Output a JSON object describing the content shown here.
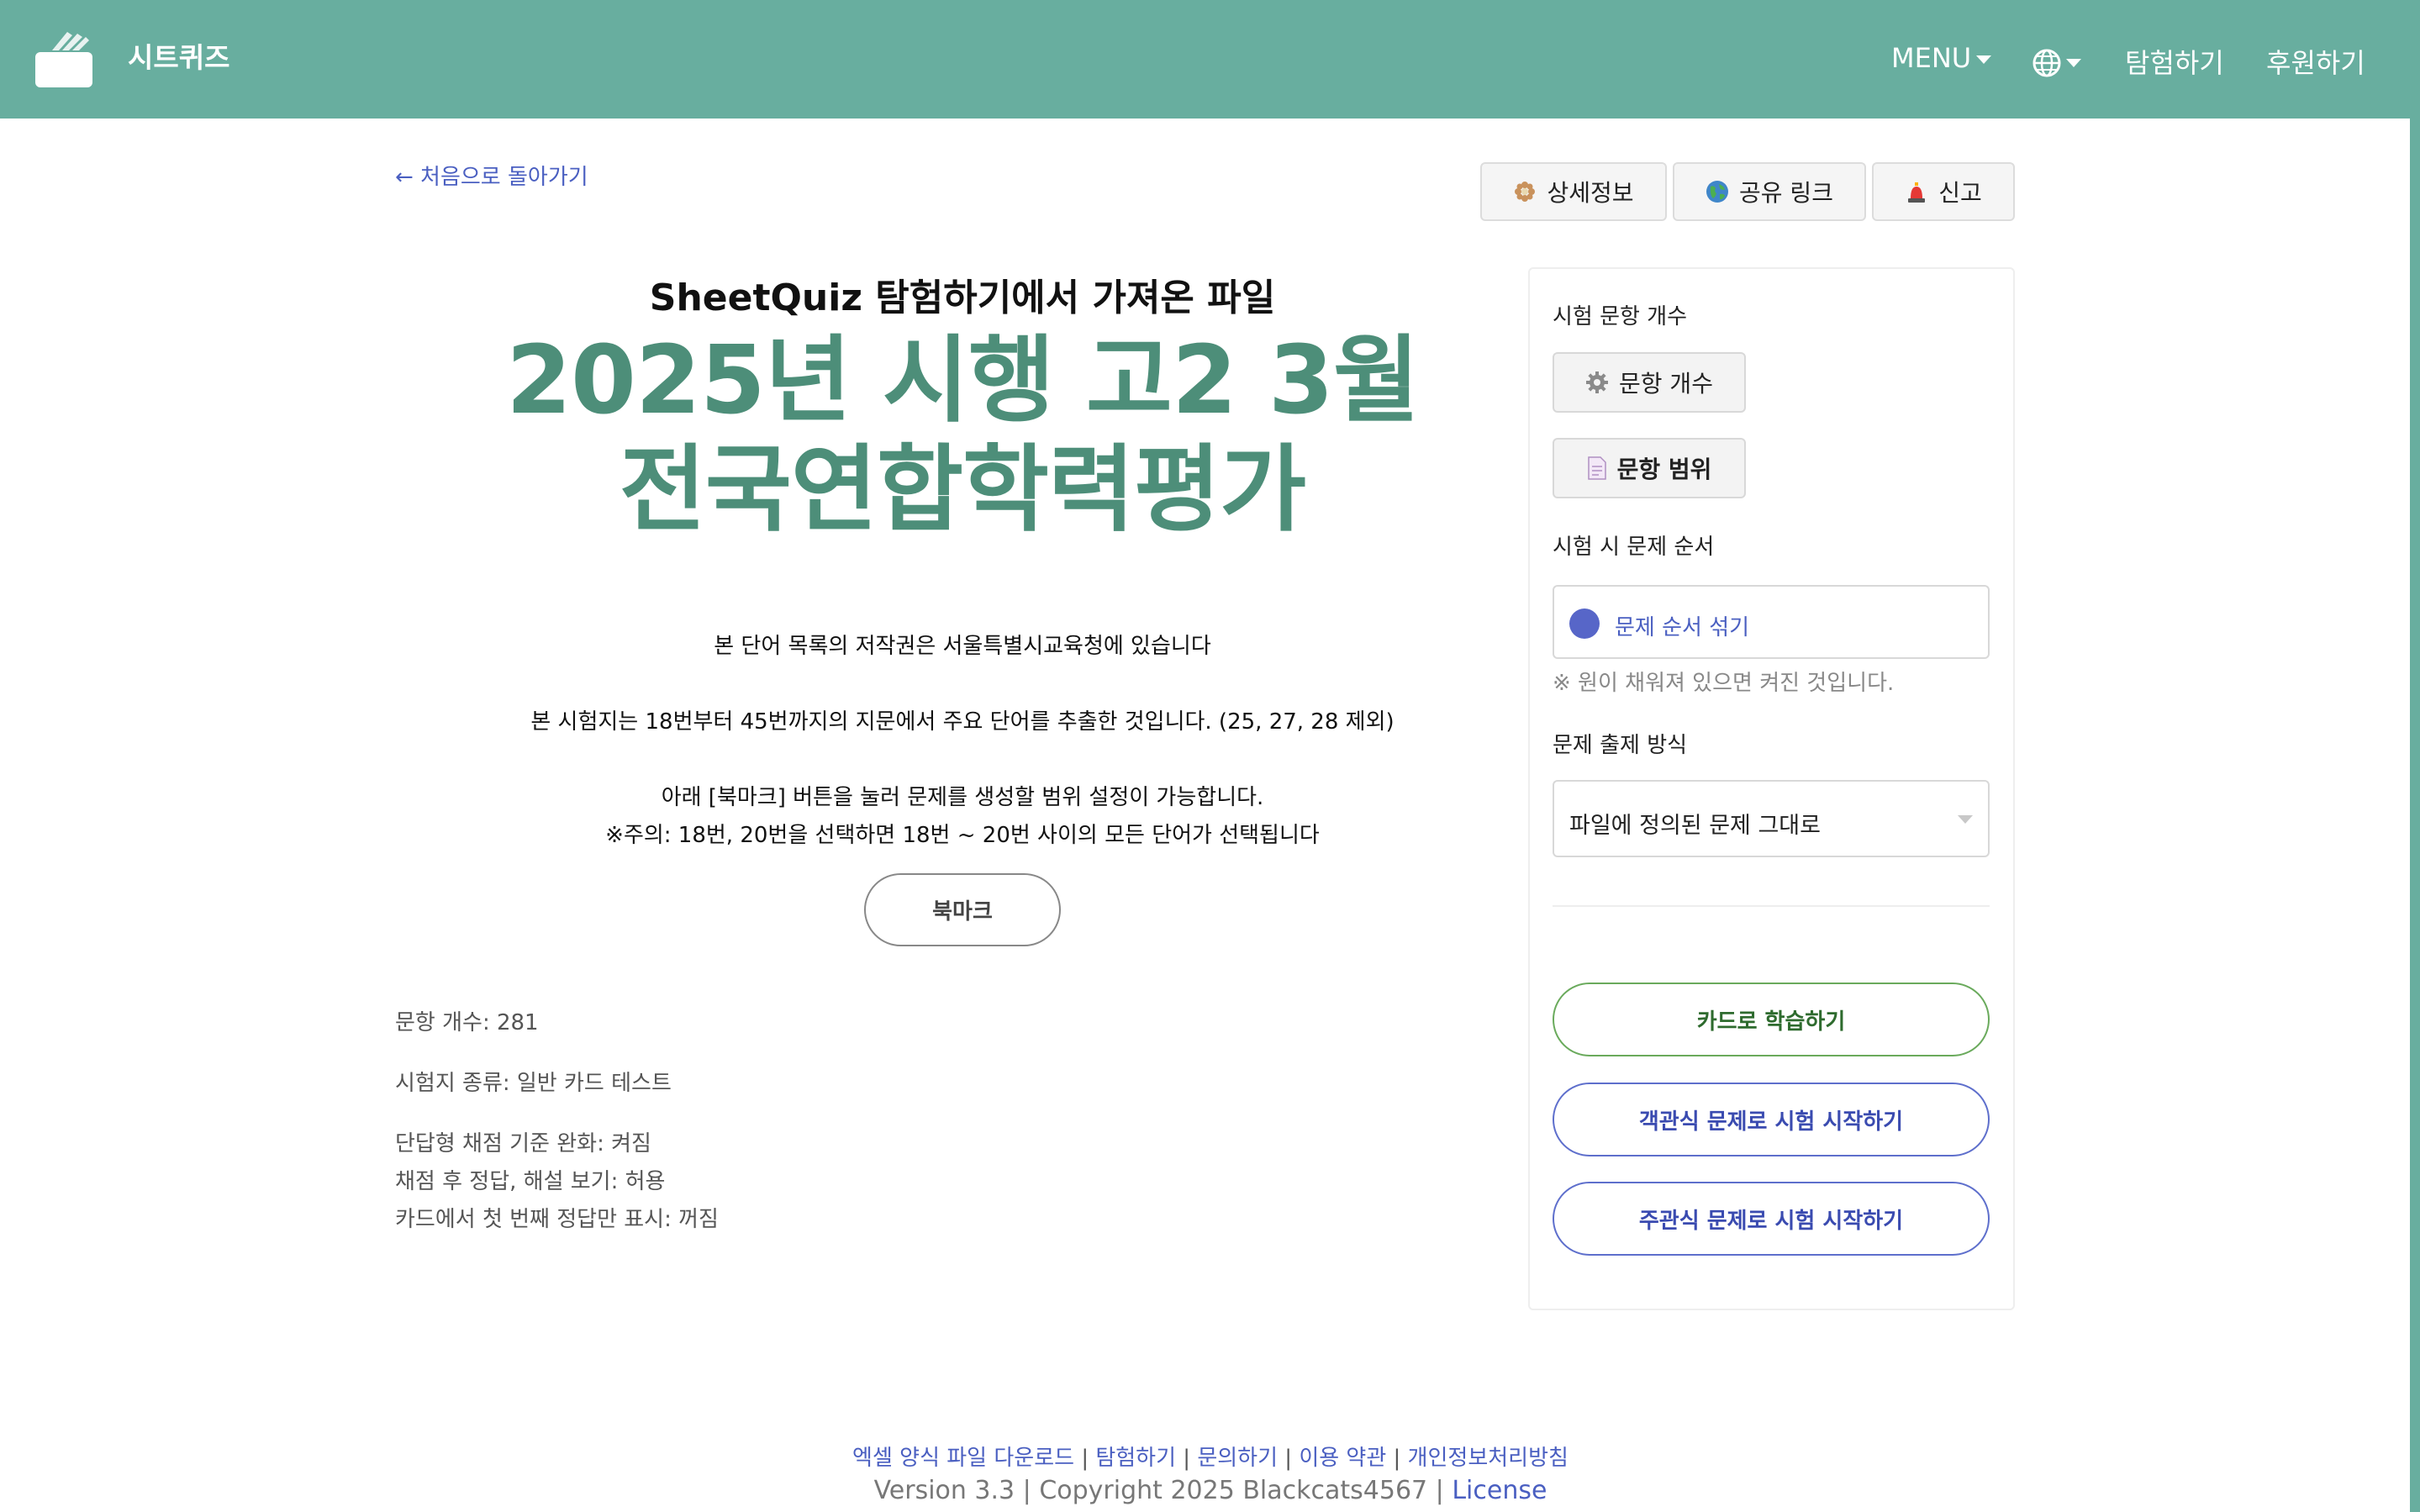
{
  "header": {
    "brand_name": "시트퀴즈",
    "menu_label": "MENU",
    "explore_label": "탐험하기",
    "donate_label": "후원하기",
    "logo_icon": "clapperboard-icon",
    "globe_icon": "globe-icon"
  },
  "back_link": "← 처음으로 돌아가기",
  "top_buttons": {
    "detail": {
      "label": "상세정보",
      "icon": "flower-icon"
    },
    "share": {
      "label": "공유 링크",
      "icon": "globe-icon"
    },
    "report": {
      "label": "신고",
      "icon": "siren-icon"
    }
  },
  "main": {
    "subtitle": "SheetQuiz 탐험하기에서 가져온 파일",
    "title_line1": "2025년 시행 고2 3월",
    "title_line2": "전국연합학력평가",
    "desc1": "본 단어 목록의 저작권은 서울특별시교육청에 있습니다",
    "desc2": "본 시험지는 18번부터 45번까지의 지문에서 주요 단어를 추출한 것입니다. (25, 27, 28 제외)",
    "desc3": "아래 [북마크] 버튼을 눌러 문제를 생성할 범위 설정이 가능합니다.",
    "desc4": "※주의: 18번, 20번을 선택하면 18번 ~ 20번 사이의 모든 단어가 선택됩니다",
    "bookmark_label": "북마크",
    "info": {
      "count": "문항 개수: 281",
      "type": "시험지 종류: 일반 카드 테스트",
      "relaxed": "단답형 채점 기준 완화: 켜짐",
      "show_answer": "채점 후 정답, 해설 보기: 허용",
      "first_only": "카드에서 첫 번째 정답만 표시: 꺼짐"
    }
  },
  "sidebar": {
    "label_count": "시험 문항 개수",
    "btn_count": "문항 개수",
    "btn_range": "문항 범위",
    "label_order": "시험 시 문제 순서",
    "shuffle_label": "문제 순서 섞기",
    "hint": "※ 원이 채워져 있으면 켜진 것입니다.",
    "label_mode": "문제 출제 방식",
    "mode_value": "파일에 정의된 문제 그대로",
    "action_card": "카드로 학습하기",
    "action_mc": "객관식 문제로 시험 시작하기",
    "action_sa": "주관식 문제로 시험 시작하기",
    "shuffle_on": true
  },
  "footer": {
    "link_excel": "엑셀 양식 파일 다운로드",
    "link_explore": "탐험하기",
    "link_contact": "문의하기",
    "link_terms": "이용 약관",
    "link_privacy": "개인정보처리방침",
    "copyright": "Version 3.3 | Copyright 2025 Blackcats4567 |",
    "license": "License"
  },
  "colors": {
    "header_bg": "#68ae9f",
    "title": "#4d8e79",
    "link": "#4a5fc1",
    "green_button": "#6aaa5c",
    "blue_button": "#5e6fcc"
  }
}
